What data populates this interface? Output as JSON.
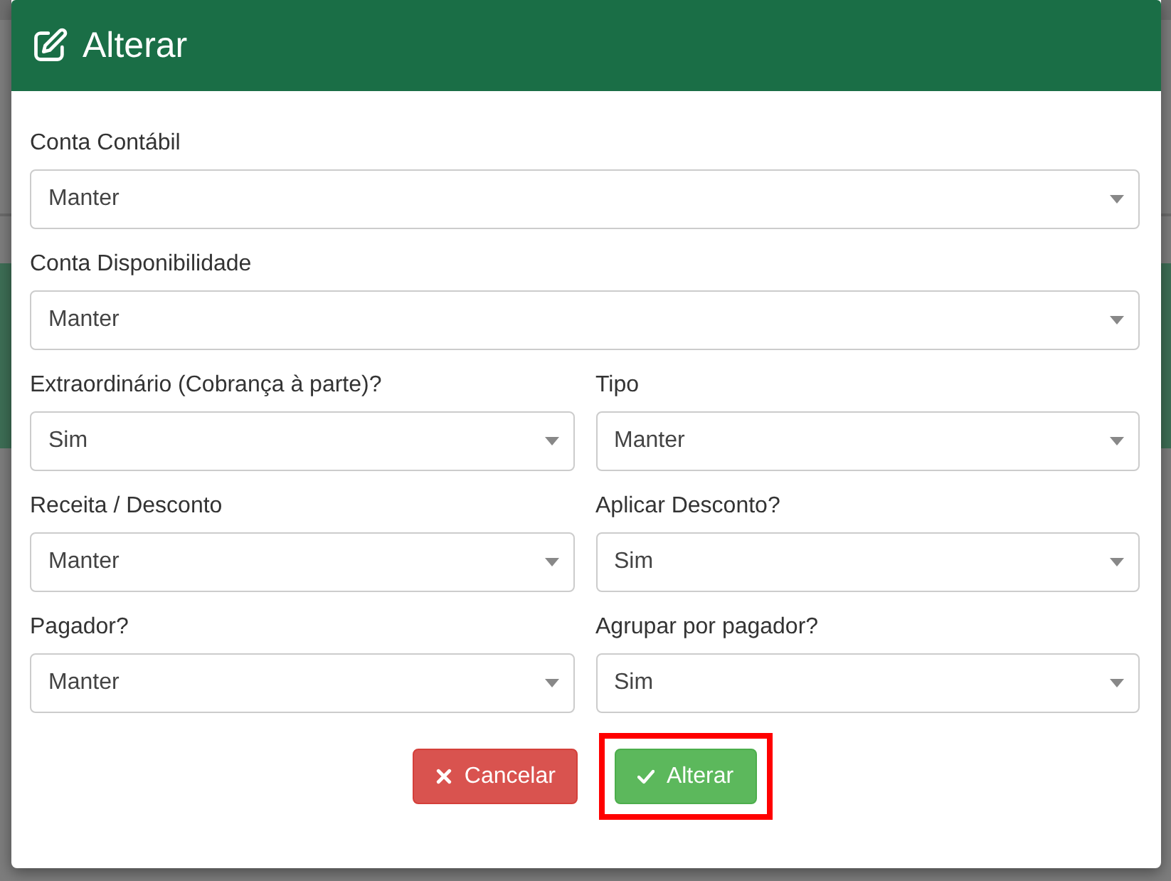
{
  "dialog": {
    "title": "Alterar",
    "fields": [
      {
        "label": "Conta Contábil",
        "value": "Manter",
        "kind": "full"
      },
      {
        "label": "Conta Disponibilidade",
        "value": "Manter",
        "kind": "full"
      },
      {
        "label": "Extraordinário (Cobrança à parte)?",
        "value": "Sim",
        "kind": "half"
      },
      {
        "label": "Tipo",
        "value": "Manter",
        "kind": "half"
      },
      {
        "label": "Receita / Desconto",
        "value": "Manter",
        "kind": "half"
      },
      {
        "label": "Aplicar Desconto?",
        "value": "Sim",
        "kind": "half"
      },
      {
        "label": "Pagador?",
        "value": "Manter",
        "kind": "half"
      },
      {
        "label": "Agrupar por pagador?",
        "value": "Sim",
        "kind": "half"
      }
    ],
    "buttons": [
      {
        "label": "Cancelar",
        "kind": "cancel",
        "highlighted": false
      },
      {
        "label": "Alterar",
        "kind": "confirm",
        "highlighted": true
      }
    ]
  }
}
